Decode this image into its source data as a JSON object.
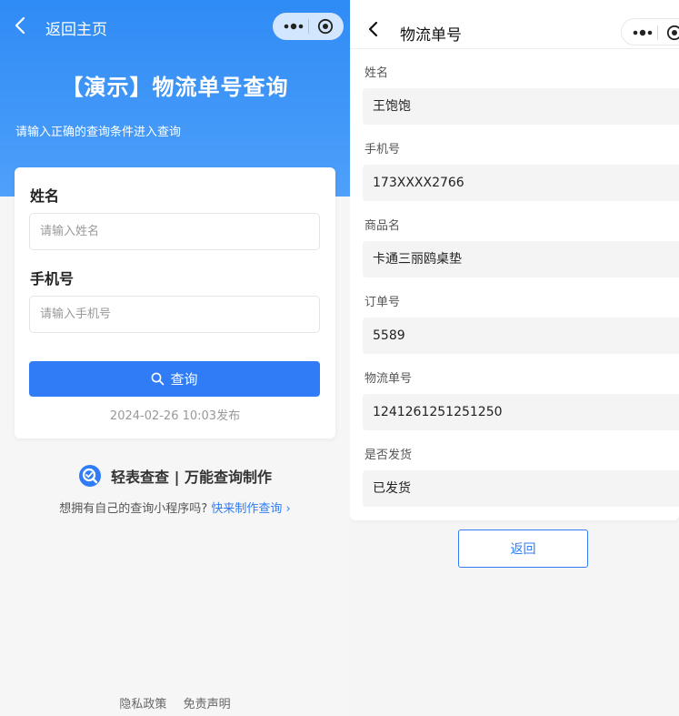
{
  "left": {
    "nav": {
      "title": "返回主页"
    },
    "hero": {
      "title": "【演示】物流单号查询",
      "subtitle": "请输入正确的查询条件进入查询"
    },
    "form": {
      "name_label": "姓名",
      "name_placeholder": "请输入姓名",
      "phone_label": "手机号",
      "phone_placeholder": "请输入手机号",
      "query_button": "查询",
      "publish_time": "2024-02-26 10:03发布"
    },
    "brand": {
      "text": "轻表查查 | 万能查询制作",
      "promo_text": "想拥有自己的查询小程序吗?",
      "promo_link": "快来制作查询 ›"
    },
    "footer": {
      "privacy": "隐私政策",
      "disclaimer": "免责声明"
    }
  },
  "right": {
    "nav": {
      "title": "物流单号"
    },
    "fields": [
      {
        "label": "姓名",
        "value": "王饱饱"
      },
      {
        "label": "手机号",
        "value": "173XXXX2766"
      },
      {
        "label": "商品名",
        "value": "卡通三丽鸥桌垫"
      },
      {
        "label": "订单号",
        "value": "5589"
      },
      {
        "label": "物流单号",
        "value": "1241261251251250"
      },
      {
        "label": "是否发货",
        "value": "已发货"
      }
    ],
    "return_button": "返回"
  },
  "colors": {
    "primary": "#2f7cf6",
    "hero_top": "#2f8bf5",
    "hero_bottom": "#4ea0fa"
  }
}
